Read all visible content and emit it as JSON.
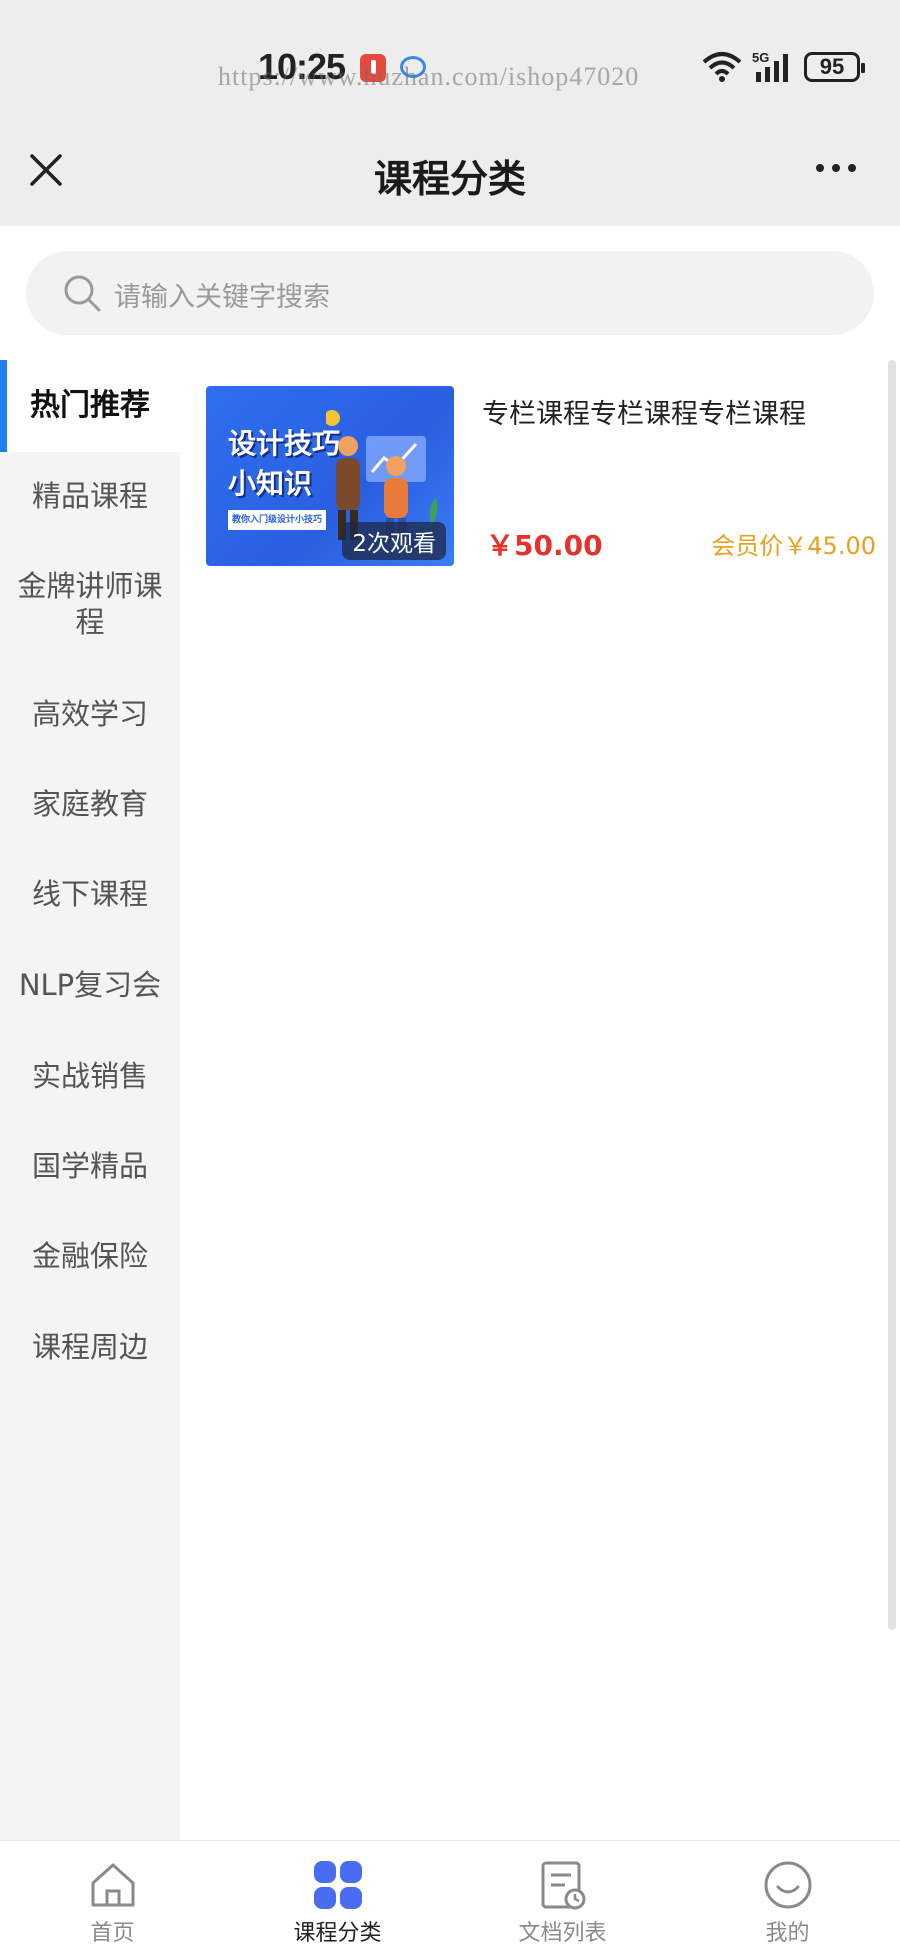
{
  "status_bar": {
    "time": "10:25",
    "watermark": "https://www.huzhan.com/ishop47020",
    "network": "5G",
    "battery": "95"
  },
  "nav": {
    "title": "课程分类"
  },
  "search": {
    "placeholder": "请输入关键字搜索"
  },
  "sidebar": {
    "items": [
      {
        "label": "热门推荐",
        "active": true
      },
      {
        "label": "精品课程"
      },
      {
        "label": "金牌讲师课程"
      },
      {
        "label": "高效学习"
      },
      {
        "label": "家庭教育"
      },
      {
        "label": "线下课程"
      },
      {
        "label": "NLP复习会"
      },
      {
        "label": "实战销售"
      },
      {
        "label": "国学精品"
      },
      {
        "label": "金融保险"
      },
      {
        "label": "课程周边"
      }
    ]
  },
  "courses": [
    {
      "title": "专栏课程专栏课程专栏课程",
      "thumb_title_line1": "设计技巧",
      "thumb_title_line2": "小知识",
      "thumb_subtitle": "教你入门级设计小技巧",
      "views": "2次观看",
      "price": "￥50.00",
      "member_price": "会员价￥45.00"
    }
  ],
  "tab_bar": {
    "tabs": [
      {
        "label": "首页",
        "icon": "home-icon"
      },
      {
        "label": "课程分类",
        "icon": "grid-icon",
        "active": true
      },
      {
        "label": "文档列表",
        "icon": "document-icon"
      },
      {
        "label": "我的",
        "icon": "smile-icon"
      }
    ]
  },
  "colors": {
    "accent": "#1f7ef5",
    "price": "#e5322d",
    "member_price": "#e8a020",
    "tab_active_icon": "#4a6cf0"
  }
}
